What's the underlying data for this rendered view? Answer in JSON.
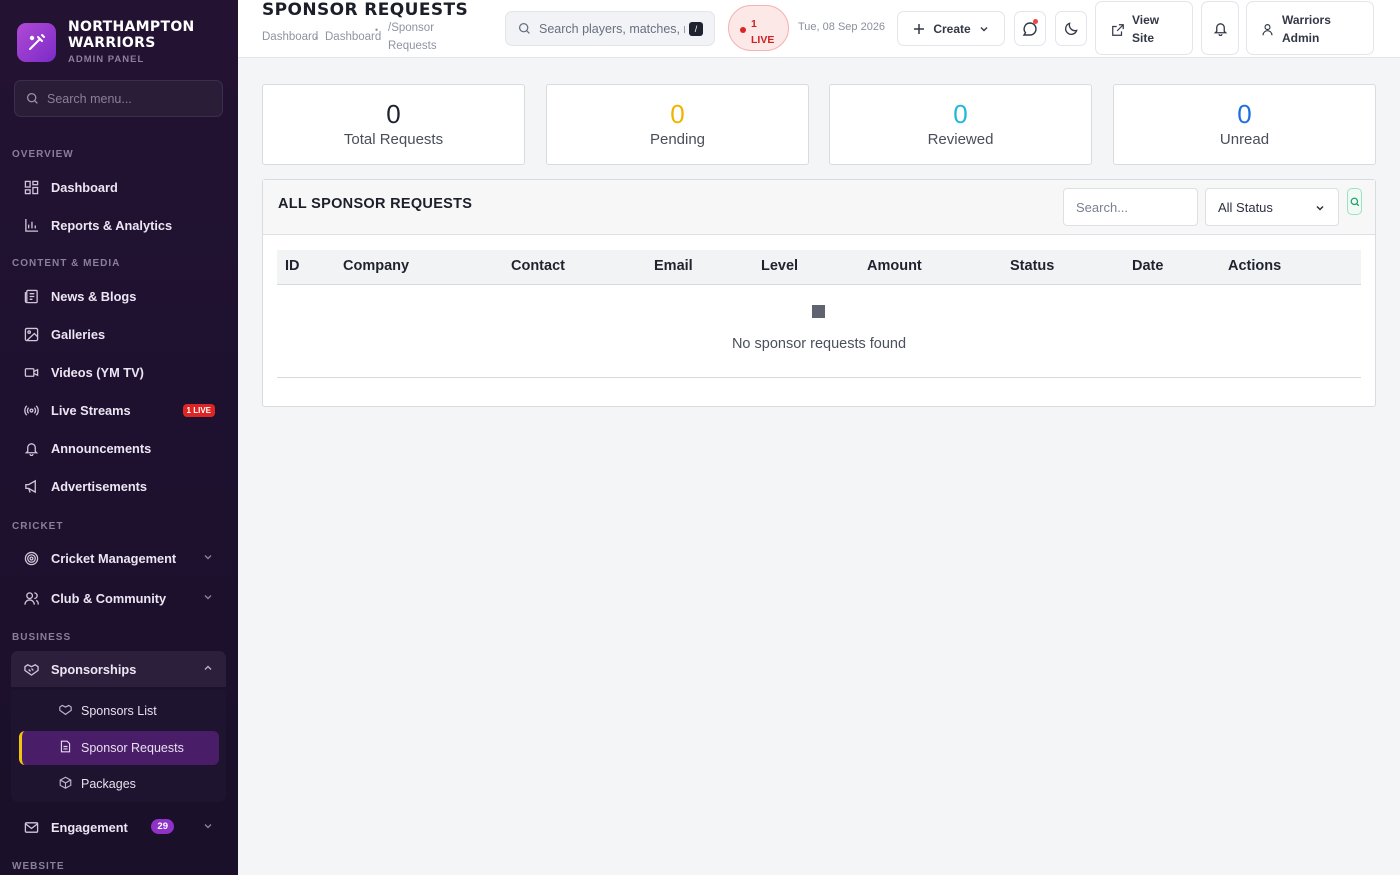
{
  "brand": {
    "name_line1": "NORTHAMPTON",
    "name_line2": "WARRIORS",
    "subtitle": "ADMIN PANEL"
  },
  "sidebar": {
    "search_placeholder": "Search menu...",
    "sections": {
      "overview": "OVERVIEW",
      "content": "CONTENT & MEDIA",
      "cricket": "CRICKET",
      "business": "BUSINESS",
      "website": "WEBSITE"
    },
    "items": {
      "dashboard": "Dashboard",
      "reports": "Reports & Analytics",
      "news": "News & Blogs",
      "galleries": "Galleries",
      "videos": "Videos (YM TV)",
      "live_streams": "Live Streams",
      "live_streams_badge": "1 LIVE",
      "announcements": "Announcements",
      "advertisements": "Advertisements",
      "cricket_mgmt": "Cricket Management",
      "club": "Club & Community",
      "sponsorships": "Sponsorships",
      "sponsors_list": "Sponsors List",
      "sponsor_requests": "Sponsor Requests",
      "packages": "Packages",
      "engagement": "Engagement",
      "engagement_badge": "29"
    }
  },
  "header": {
    "title": "SPONSOR REQUESTS",
    "breadcrumb": [
      "Dashboard",
      "Dashboard",
      "/Sponsor",
      "Requests"
    ],
    "search_placeholder": "Search players, matches, n",
    "search_shortcut": "/",
    "live_count": "1",
    "live_label": "LIVE",
    "date": "Tue, 08 Sep 2026",
    "create_label": "Create",
    "view_site_line1": "View",
    "view_site_line2": "Site",
    "user_line1": "Warriors",
    "user_line2": "Admin"
  },
  "stats": [
    {
      "value": "0",
      "label": "Total Requests",
      "color": "#1f2330"
    },
    {
      "value": "0",
      "label": "Pending",
      "color": "#f0b400"
    },
    {
      "value": "0",
      "label": "Reviewed",
      "color": "#1fb8d8"
    },
    {
      "value": "0",
      "label": "Unread",
      "color": "#1e6fe0"
    }
  ],
  "table": {
    "title": "ALL SPONSOR REQUESTS",
    "search_placeholder": "Search...",
    "status_filter": "All Status",
    "columns": [
      "ID",
      "Company",
      "Contact",
      "Email",
      "Level",
      "Amount",
      "Status",
      "Date",
      "Actions"
    ],
    "empty_message": "No sponsor requests found"
  },
  "colors": {
    "accent": "#8e32c8",
    "sidebar_bg": "#1e1130",
    "live_red": "#dc2626",
    "active_marker": "#f1c40f"
  }
}
